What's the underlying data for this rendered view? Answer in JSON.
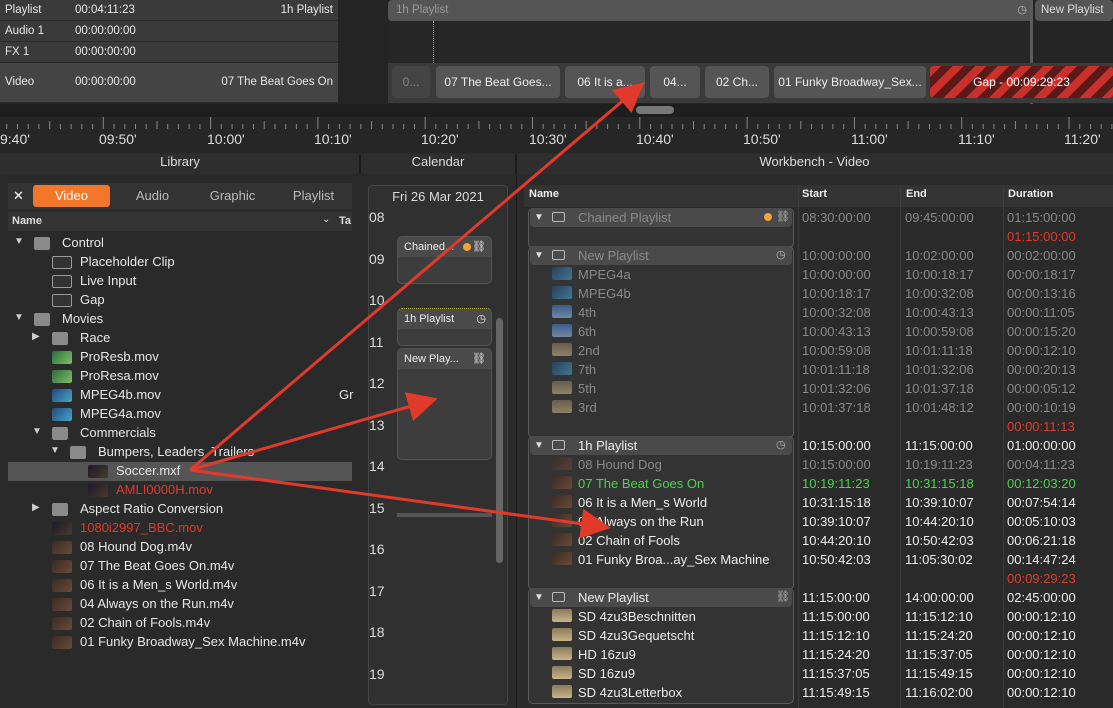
{
  "tracks": {
    "rows": [
      {
        "name": "Playlist",
        "time": "00:04:11:23",
        "clip": "1h Playlist"
      },
      {
        "name": "Audio 1",
        "time": "00:00:00:00",
        "clip": ""
      },
      {
        "name": "FX 1",
        "time": "00:00:00:00",
        "clip": ""
      },
      {
        "name": "Video",
        "time": "00:00:00:00",
        "clip": "07 The Beat Goes On"
      }
    ],
    "playlist_bar_label": "1h Playlist",
    "new_playlist_label": "New Playlist",
    "clips": [
      "0...",
      "07 The Beat Goes...",
      "06 It is a...",
      "04...",
      "02 Ch...",
      "01 Funky Broadway_Sex..."
    ],
    "gap_label": "Gap - 00:09:29:23"
  },
  "ruler": {
    "ticks": [
      "9:40'",
      "09:50'",
      "10:00'",
      "10:10'",
      "10:20'",
      "10:30'",
      "10:40'",
      "10:50'",
      "11:00'",
      "11:10'",
      "11:20'"
    ]
  },
  "panels": {
    "library": "Library",
    "calendar": "Calendar",
    "workbench": "Workbench - Video"
  },
  "library": {
    "tabs": [
      "Video",
      "Audio",
      "Graphic",
      "Playlist"
    ],
    "close_glyph": "✕",
    "col_name": "Name",
    "col_tag": "Ta",
    "items": [
      {
        "label": "Control",
        "type": "folder",
        "indent": 0,
        "twisty": "▼"
      },
      {
        "label": "Placeholder Clip",
        "type": "tool",
        "indent": 1,
        "twisty": ""
      },
      {
        "label": "Live Input",
        "type": "tool",
        "indent": 1,
        "twisty": ""
      },
      {
        "label": "Gap",
        "type": "tool",
        "indent": 1,
        "twisty": ""
      },
      {
        "label": "Movies",
        "type": "folder",
        "indent": 0,
        "twisty": "▼"
      },
      {
        "label": "Race",
        "type": "folder",
        "indent": 1,
        "twisty": "▶"
      },
      {
        "label": "ProResb.mov",
        "type": "green",
        "indent": 1,
        "twisty": ""
      },
      {
        "label": "ProResa.mov",
        "type": "green",
        "indent": 1,
        "twisty": ""
      },
      {
        "label": "MPEG4b.mov",
        "type": "blue",
        "indent": 1,
        "twisty": "",
        "tag": "Gr"
      },
      {
        "label": "MPEG4a.mov",
        "type": "blue",
        "indent": 1,
        "twisty": ""
      },
      {
        "label": "Commercials",
        "type": "folder",
        "indent": 1,
        "twisty": "▼"
      },
      {
        "label": "Bumpers, Leaders, Trailers",
        "type": "folder",
        "indent": 2,
        "twisty": "▼"
      },
      {
        "label": "Soccer.mxf",
        "type": "dark",
        "indent": 3,
        "twisty": "",
        "selected": true
      },
      {
        "label": "AMLI0000H.mov",
        "type": "dark",
        "indent": 3,
        "twisty": "",
        "red": true
      },
      {
        "label": "Aspect Ratio Conversion",
        "type": "folder",
        "indent": 1,
        "twisty": "▶"
      },
      {
        "label": "1080i2997_BBC.mov",
        "type": "dark",
        "indent": 1,
        "twisty": "",
        "red": true
      },
      {
        "label": "08 Hound Dog.m4v",
        "type": "brown",
        "indent": 1,
        "twisty": ""
      },
      {
        "label": "07 The Beat Goes On.m4v",
        "type": "brown",
        "indent": 1,
        "twisty": ""
      },
      {
        "label": "06 It is a Men_s World.m4v",
        "type": "brown",
        "indent": 1,
        "twisty": ""
      },
      {
        "label": "04 Always on the Run.m4v",
        "type": "brown",
        "indent": 1,
        "twisty": ""
      },
      {
        "label": "02 Chain of Fools.m4v",
        "type": "brown",
        "indent": 1,
        "twisty": ""
      },
      {
        "label": "01 Funky Broadway_Sex Machine.m4v",
        "type": "brown",
        "indent": 1,
        "twisty": ""
      }
    ]
  },
  "calendar": {
    "date": "Fri 26 Mar 2021",
    "hours": [
      "08",
      "09",
      "10",
      "11",
      "12",
      "13",
      "14",
      "15",
      "16",
      "17",
      "18",
      "19"
    ],
    "blocks": [
      "Chained...",
      "1h Playlist",
      "New Play..."
    ]
  },
  "workbench": {
    "columns": [
      "Name",
      "Start",
      "End",
      "Duration"
    ],
    "rows": [
      {
        "kind": "group",
        "name": "Chained Playlist",
        "start": "08:30:00:00",
        "end": "09:45:00:00",
        "dur": "01:15:00:00",
        "dim": true
      },
      {
        "kind": "red",
        "dur": "01:15:00:00"
      },
      {
        "kind": "group",
        "name": "New Playlist",
        "start": "10:00:00:00",
        "end": "10:02:00:00",
        "dur": "00:02:00:00",
        "dim": true
      },
      {
        "kind": "item",
        "name": "MPEG4a",
        "start": "10:00:00:00",
        "end": "10:00:18:17",
        "dur": "00:00:18:17",
        "dim": true,
        "thumb": "blue"
      },
      {
        "kind": "item",
        "name": "MPEG4b",
        "start": "10:00:18:17",
        "end": "10:00:32:08",
        "dur": "00:00:13:16",
        "dim": true,
        "thumb": "blue"
      },
      {
        "kind": "item",
        "name": "4th",
        "start": "10:00:32:08",
        "end": "10:00:43:13",
        "dur": "00:00:11:05",
        "dim": true,
        "thumb": "sky"
      },
      {
        "kind": "item",
        "name": "6th",
        "start": "10:00:43:13",
        "end": "10:00:59:08",
        "dur": "00:00:15:20",
        "dim": true,
        "thumb": "sky"
      },
      {
        "kind": "item",
        "name": "2nd",
        "start": "10:00:59:08",
        "end": "10:01:11:18",
        "dur": "00:00:12:10",
        "dim": true,
        "thumb": "sand"
      },
      {
        "kind": "item",
        "name": "7th",
        "start": "10:01:11:18",
        "end": "10:01:32:06",
        "dur": "00:00:20:13",
        "dim": true,
        "thumb": "blue"
      },
      {
        "kind": "item",
        "name": "5th",
        "start": "10:01:32:06",
        "end": "10:01:37:18",
        "dur": "00:00:05:12",
        "dim": true,
        "thumb": "sand"
      },
      {
        "kind": "item",
        "name": "3rd",
        "start": "10:01:37:18",
        "end": "10:01:48:12",
        "dur": "00:00:10:19",
        "dim": true,
        "thumb": "sand"
      },
      {
        "kind": "red",
        "dur": "00:00:11:13"
      },
      {
        "kind": "group",
        "name": "1h Playlist",
        "start": "10:15:00:00",
        "end": "11:15:00:00",
        "dur": "01:00:00:00"
      },
      {
        "kind": "item",
        "name": "08 Hound Dog",
        "start": "10:15:00:00",
        "end": "10:19:11:23",
        "dur": "00:04:11:23",
        "dim": true,
        "thumb": "brown"
      },
      {
        "kind": "item",
        "name": "07 The Beat Goes On",
        "start": "10:19:11:23",
        "end": "10:31:15:18",
        "dur": "00:12:03:20",
        "green": true,
        "thumb": "brown"
      },
      {
        "kind": "item",
        "name": "06 It is a Men_s World",
        "start": "10:31:15:18",
        "end": "10:39:10:07",
        "dur": "00:07:54:14",
        "thumb": "brown"
      },
      {
        "kind": "item",
        "name": "04 Always on the Run",
        "start": "10:39:10:07",
        "end": "10:44:20:10",
        "dur": "00:05:10:03",
        "thumb": "brown"
      },
      {
        "kind": "item",
        "name": "02 Chain of Fools",
        "start": "10:44:20:10",
        "end": "10:50:42:03",
        "dur": "00:06:21:18",
        "thumb": "brown"
      },
      {
        "kind": "item",
        "name": "01 Funky Broa...ay_Sex Machine",
        "start": "10:50:42:03",
        "end": "11:05:30:02",
        "dur": "00:14:47:24",
        "thumb": "brown"
      },
      {
        "kind": "red",
        "dur": "00:09:29:23"
      },
      {
        "kind": "group",
        "name": "New Playlist",
        "start": "11:15:00:00",
        "end": "14:00:00:00",
        "dur": "02:45:00:00"
      },
      {
        "kind": "item",
        "name": "SD 4zu3Beschnitten",
        "start": "11:15:00:00",
        "end": "11:15:12:10",
        "dur": "00:00:12:10",
        "thumb": "sand"
      },
      {
        "kind": "item",
        "name": "SD 4zu3Gequetscht",
        "start": "11:15:12:10",
        "end": "11:15:24:20",
        "dur": "00:00:12:10",
        "thumb": "sand"
      },
      {
        "kind": "item",
        "name": "HD 16zu9",
        "start": "11:15:24:20",
        "end": "11:15:37:05",
        "dur": "00:00:12:10",
        "thumb": "sand"
      },
      {
        "kind": "item",
        "name": "SD 16zu9",
        "start": "11:15:37:05",
        "end": "11:15:49:15",
        "dur": "00:00:12:10",
        "thumb": "sand"
      },
      {
        "kind": "item",
        "name": "SD 4zu3Letterbox",
        "start": "11:15:49:15",
        "end": "11:16:02:00",
        "dur": "00:00:12:10",
        "thumb": "sand"
      }
    ]
  },
  "colors": {
    "accent": "#f2772a",
    "red": "#e23a2a",
    "green": "#4fd24f",
    "dim": "#8a8a8a"
  }
}
